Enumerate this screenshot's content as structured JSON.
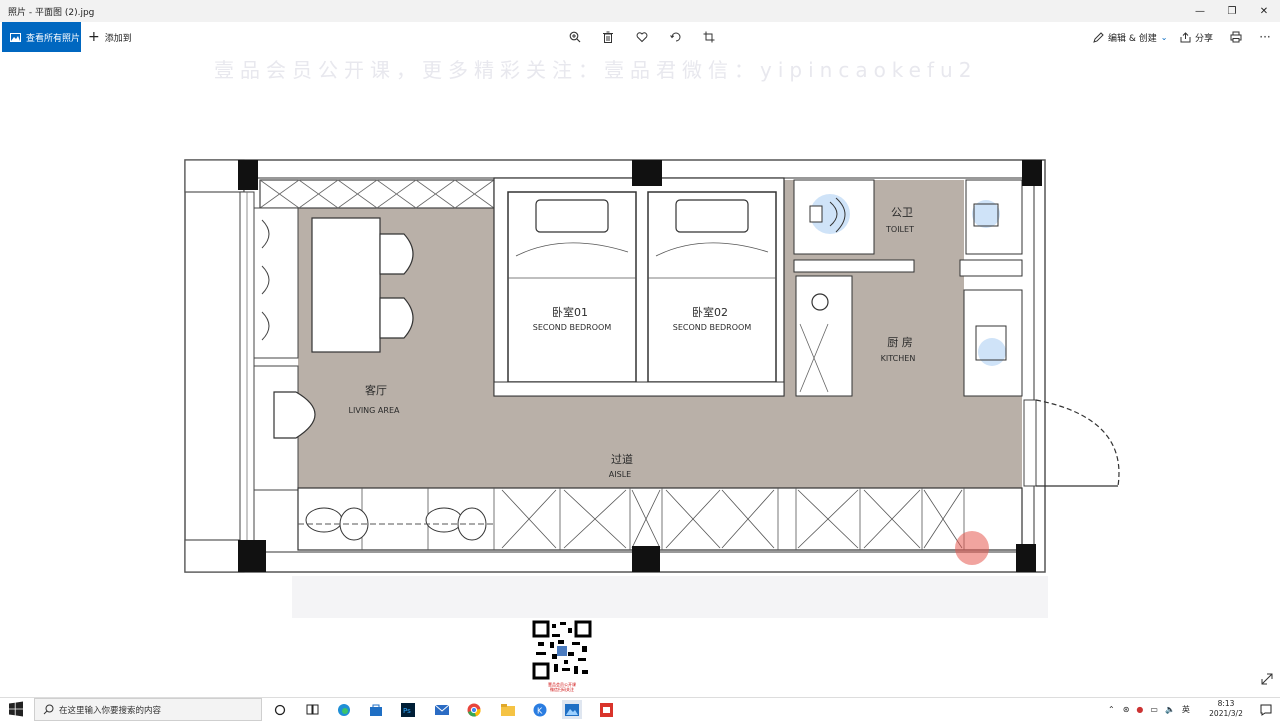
{
  "window": {
    "title": "照片 - 平面图 (2).jpg",
    "controls": [
      "minimize",
      "maximize",
      "close"
    ]
  },
  "toolbar": {
    "view_all_label": "查看所有照片",
    "add_to_label": "添加到",
    "edit_create_label": "编辑 & 创建",
    "share_label": "分享",
    "tools": [
      "zoom-icon",
      "delete-icon",
      "favorite-icon",
      "rotate-icon",
      "crop-icon"
    ]
  },
  "image": {
    "watermark": "壹品会员公开课，更多精彩关注：壹品君微信：yipincaokefu2",
    "rooms": {
      "bedroom1": {
        "cn": "卧室01",
        "en": "SECOND BEDROOM"
      },
      "bedroom2": {
        "cn": "卧室02",
        "en": "SECOND BEDROOM"
      },
      "toilet": {
        "cn": "公卫",
        "en": "TOILET"
      },
      "kitchen": {
        "cn": "厨 房",
        "en": "KITCHEN"
      },
      "living": {
        "cn": "客厅",
        "en": "LIVING AREA"
      },
      "aisle": {
        "cn": "过道",
        "en": "AISLE"
      }
    },
    "qr_caption_1": "壹品会员公开课",
    "qr_caption_2": "微信扫码关注"
  },
  "taskbar": {
    "search_placeholder": "在这里输入你要搜索的内容",
    "apps": [
      "cortana-icon",
      "task-view-icon",
      "edge-icon",
      "store-icon",
      "photoshop-icon",
      "mail-icon",
      "chrome-icon",
      "explorer-icon",
      "k-app-icon",
      "photos-app-icon",
      "pdf-icon"
    ],
    "ime": "英",
    "time": "8:13",
    "date": "2021/3/2"
  },
  "colors": {
    "accent": "#0067c0",
    "floor": "#b9b0a8",
    "wall": "#ffffff",
    "column": "#111111"
  }
}
